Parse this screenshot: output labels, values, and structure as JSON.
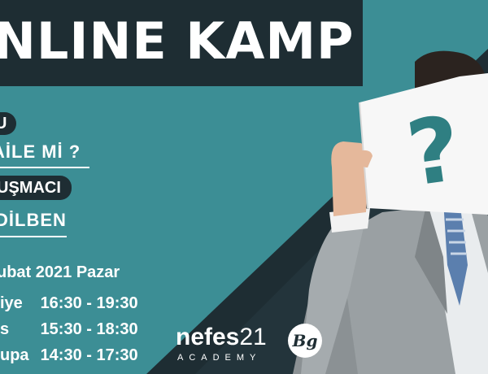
{
  "banner": {
    "title": "NLINE KAMP",
    "topic_tag": "U",
    "topic": "AİLE Mİ ?",
    "speaker_tag": "UŞMACI",
    "speaker": "DİLBEN",
    "date": "ubat 2021 Pazar",
    "schedule": [
      {
        "region": "iye",
        "time": "16:30 - 19:30"
      },
      {
        "region": "s",
        "time": "15:30 - 18:30"
      },
      {
        "region": "upa",
        "time": "14:30 - 17:30"
      }
    ]
  },
  "logo": {
    "brand_word": "nefes",
    "brand_num": "21",
    "sub": "ACADEMY",
    "badge": "Bg"
  },
  "image": {
    "question_mark": "?"
  },
  "colors": {
    "teal": "#3c8e95",
    "dark": "#1e2d33",
    "white": "#ffffff"
  }
}
